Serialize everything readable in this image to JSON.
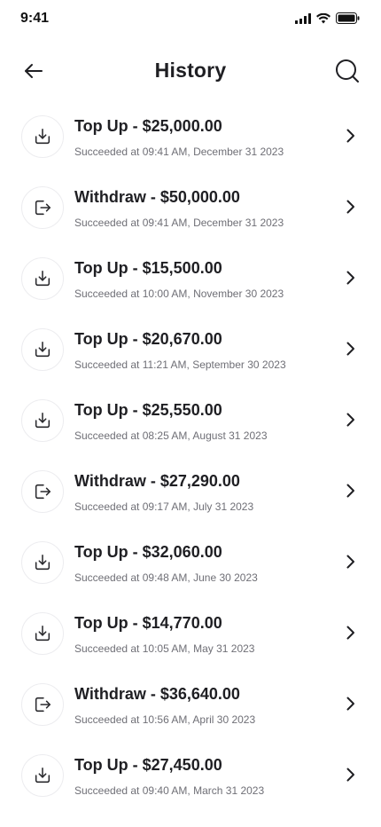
{
  "status_bar": {
    "time": "9:41"
  },
  "header": {
    "title": "History"
  },
  "transactions": [
    {
      "type": "topup",
      "title": "Top Up - $25,000.00",
      "subtitle": "Succeeded at 09:41 AM, December 31 2023"
    },
    {
      "type": "withdraw",
      "title": "Withdraw - $50,000.00",
      "subtitle": "Succeeded at 09:41 AM, December 31 2023"
    },
    {
      "type": "topup",
      "title": "Top Up - $15,500.00",
      "subtitle": "Succeeded at 10:00 AM, November 30 2023"
    },
    {
      "type": "topup",
      "title": "Top Up - $20,670.00",
      "subtitle": "Succeeded at 11:21 AM, September 30 2023"
    },
    {
      "type": "topup",
      "title": "Top Up - $25,550.00",
      "subtitle": "Succeeded at 08:25 AM, August 31 2023"
    },
    {
      "type": "withdraw",
      "title": "Withdraw - $27,290.00",
      "subtitle": "Succeeded at 09:17 AM, July 31 2023"
    },
    {
      "type": "topup",
      "title": "Top Up - $32,060.00",
      "subtitle": "Succeeded at 09:48 AM, June 30 2023"
    },
    {
      "type": "topup",
      "title": "Top Up - $14,770.00",
      "subtitle": "Succeeded at 10:05 AM, May 31 2023"
    },
    {
      "type": "withdraw",
      "title": "Withdraw - $36,640.00",
      "subtitle": "Succeeded at 10:56 AM, April 30 2023"
    },
    {
      "type": "topup",
      "title": "Top Up - $27,450.00",
      "subtitle": "Succeeded at 09:40 AM, March 31 2023"
    }
  ],
  "icons": {
    "topup": "download-tray-icon",
    "withdraw": "logout-arrow-icon",
    "back": "arrow-left-icon",
    "search": "search-icon",
    "row": "chevron-right-icon"
  }
}
